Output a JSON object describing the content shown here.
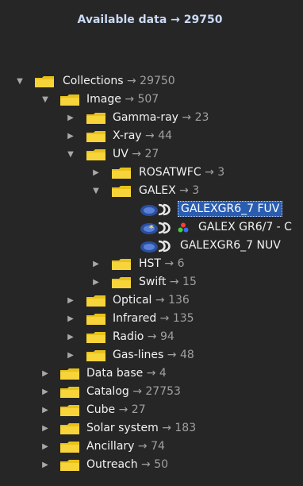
{
  "header": {
    "title": "Available data",
    "arrow": "→",
    "total": "29750"
  },
  "tree": {
    "collections": {
      "label": "Collections",
      "count": "→ 29750"
    },
    "image": {
      "label": "Image",
      "count": "→ 507"
    },
    "gamma": {
      "label": "Gamma-ray",
      "count": "→ 23"
    },
    "xray": {
      "label": "X-ray",
      "count": "→ 44"
    },
    "uv": {
      "label": "UV",
      "count": "→ 27"
    },
    "rosat": {
      "label": "ROSATWFC",
      "count": "→ 3"
    },
    "galex": {
      "label": "GALEX",
      "count": "→ 3"
    },
    "galex_fuv": {
      "label": "GALEXGR6_7 FUV"
    },
    "galex_color": {
      "label": "GALEX GR6/7 - C"
    },
    "galex_nuv": {
      "label": "GALEXGR6_7 NUV"
    },
    "hst": {
      "label": "HST",
      "count": "→ 6"
    },
    "swift": {
      "label": "Swift",
      "count": "→ 15"
    },
    "optical": {
      "label": "Optical",
      "count": "→ 136"
    },
    "infrared": {
      "label": "Infrared",
      "count": "→ 135"
    },
    "radio": {
      "label": "Radio",
      "count": "→ 94"
    },
    "gaslines": {
      "label": "Gas-lines",
      "count": "→ 48"
    },
    "database": {
      "label": "Data base",
      "count": "→ 4"
    },
    "catalog": {
      "label": "Catalog",
      "count": "→ 27753"
    },
    "cube": {
      "label": "Cube",
      "count": "→ 27"
    },
    "solar": {
      "label": "Solar system",
      "count": "→ 183"
    },
    "ancillary": {
      "label": "Ancillary",
      "count": "→ 74"
    },
    "outreach": {
      "label": "Outreach",
      "count": "→ 50"
    }
  },
  "icons": {
    "expanded": "triangle-down",
    "collapsed": "triangle-right",
    "folder": "folder-icon",
    "hips": "plug-icon"
  },
  "colors": {
    "background": "#262626",
    "header": "#c9d9f5",
    "selection": "#2a5db0",
    "count": "#a0a0a0",
    "folder": "#e8c21a"
  }
}
